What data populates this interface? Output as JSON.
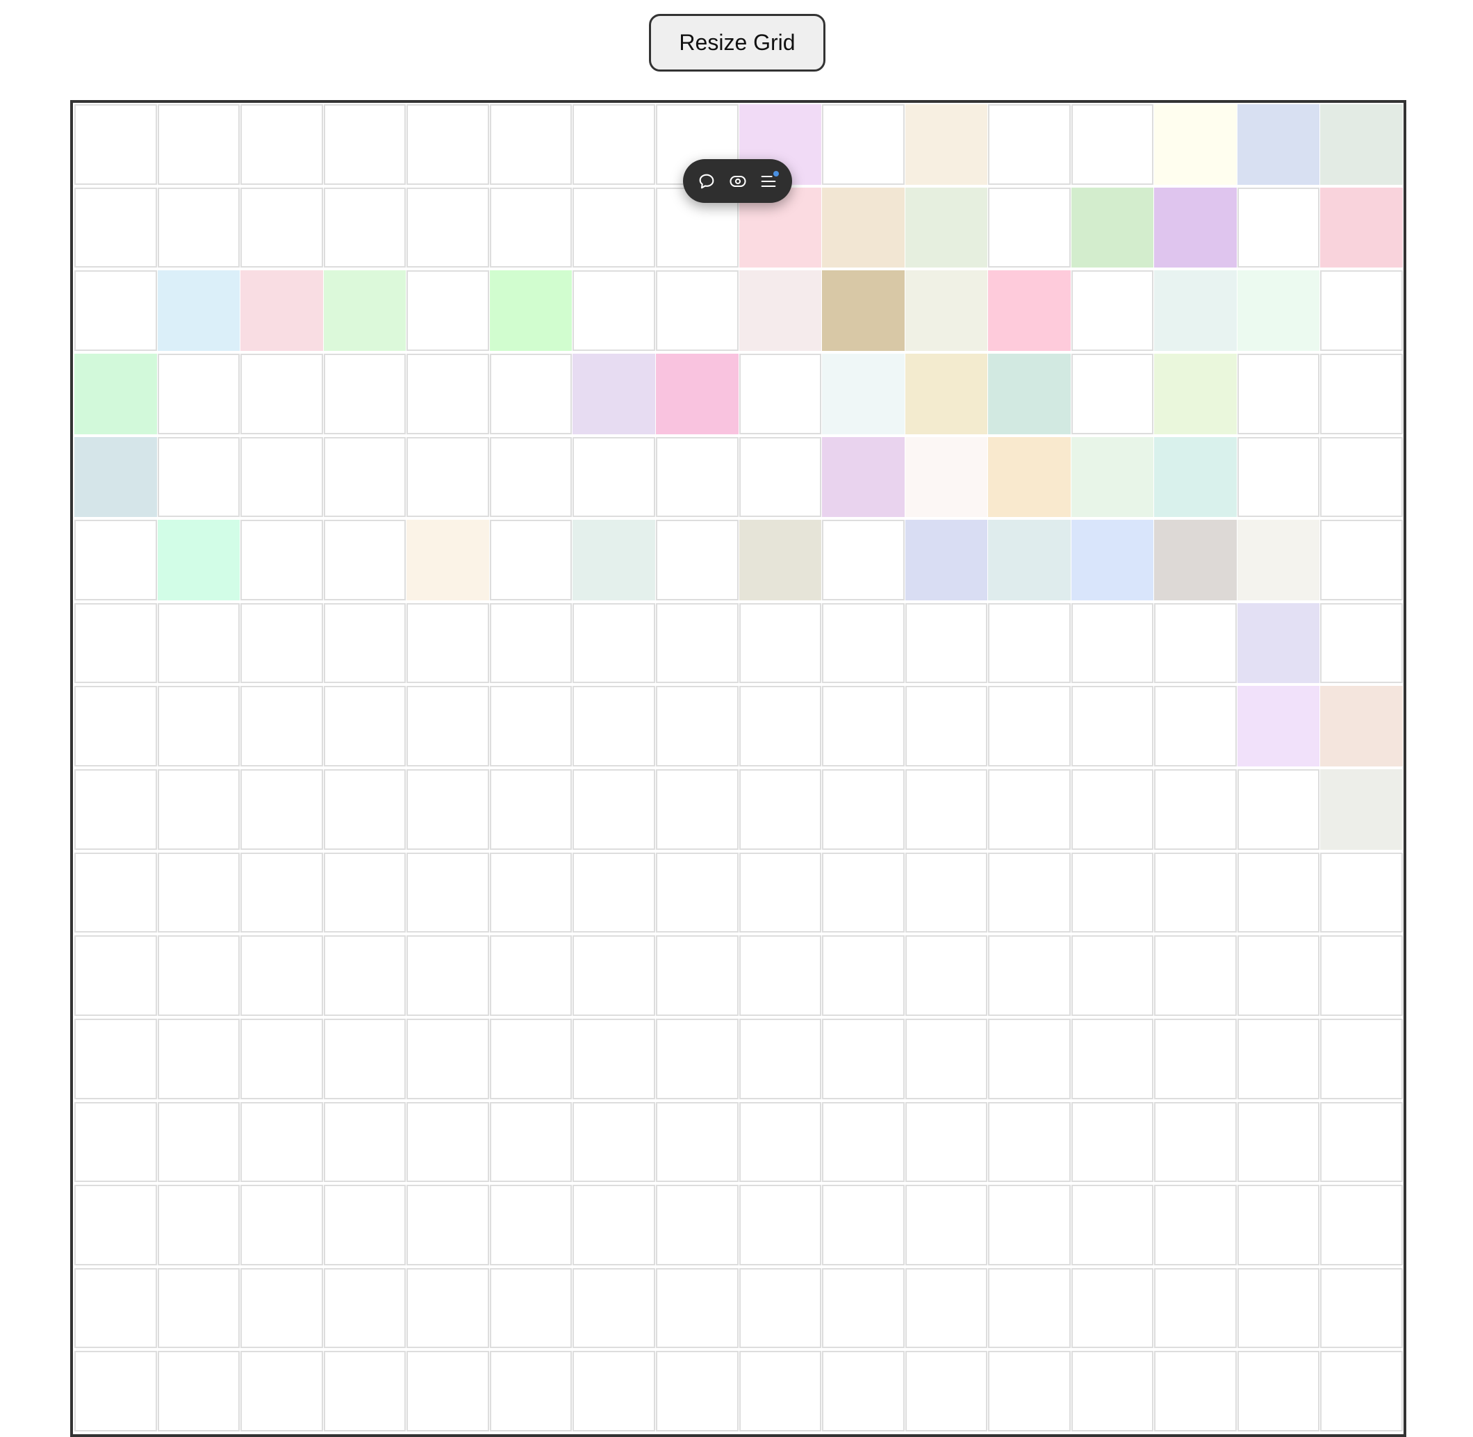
{
  "toolbar": {
    "resize_label": "Resize Grid"
  },
  "grid": {
    "rows": 16,
    "cols": 16,
    "empty_color": "#ffffff",
    "filled_cells": [
      {
        "r": 0,
        "c": 8,
        "color": "#f1dbf6"
      },
      {
        "r": 0,
        "c": 10,
        "color": "#f7efe1"
      },
      {
        "r": 0,
        "c": 13,
        "color": "#fffeef"
      },
      {
        "r": 0,
        "c": 14,
        "color": "#d8e0f2"
      },
      {
        "r": 0,
        "c": 15,
        "color": "#e3ebe4"
      },
      {
        "r": 1,
        "c": 8,
        "color": "#fbdbe1"
      },
      {
        "r": 1,
        "c": 9,
        "color": "#f2e6d3"
      },
      {
        "r": 1,
        "c": 10,
        "color": "#e6efdf"
      },
      {
        "r": 1,
        "c": 12,
        "color": "#d3edcd"
      },
      {
        "r": 1,
        "c": 13,
        "color": "#dfc5ee"
      },
      {
        "r": 1,
        "c": 15,
        "color": "#f9d3dc"
      },
      {
        "r": 2,
        "c": 1,
        "color": "#dbeff9"
      },
      {
        "r": 2,
        "c": 2,
        "color": "#f9dde3"
      },
      {
        "r": 2,
        "c": 3,
        "color": "#dcf9da"
      },
      {
        "r": 2,
        "c": 5,
        "color": "#d1fdcf"
      },
      {
        "r": 2,
        "c": 8,
        "color": "#f5ebec"
      },
      {
        "r": 2,
        "c": 9,
        "color": "#d8c8a6"
      },
      {
        "r": 2,
        "c": 10,
        "color": "#f0f1e5"
      },
      {
        "r": 2,
        "c": 11,
        "color": "#fecbdb"
      },
      {
        "r": 2,
        "c": 13,
        "color": "#e8f3f1"
      },
      {
        "r": 2,
        "c": 14,
        "color": "#ecfaf0"
      },
      {
        "r": 3,
        "c": 0,
        "color": "#d2f9da"
      },
      {
        "r": 3,
        "c": 6,
        "color": "#e7dcf2"
      },
      {
        "r": 3,
        "c": 7,
        "color": "#f9c3df"
      },
      {
        "r": 3,
        "c": 9,
        "color": "#eff7f7"
      },
      {
        "r": 3,
        "c": 10,
        "color": "#f3ebcf"
      },
      {
        "r": 3,
        "c": 11,
        "color": "#d2e9e1"
      },
      {
        "r": 3,
        "c": 13,
        "color": "#eaf7dc"
      },
      {
        "r": 4,
        "c": 0,
        "color": "#d5e5e9"
      },
      {
        "r": 4,
        "c": 9,
        "color": "#e9d3ee"
      },
      {
        "r": 4,
        "c": 10,
        "color": "#fcf7f5"
      },
      {
        "r": 4,
        "c": 11,
        "color": "#f9e9ce"
      },
      {
        "r": 4,
        "c": 12,
        "color": "#e8f5e8"
      },
      {
        "r": 4,
        "c": 13,
        "color": "#d9f1ec"
      },
      {
        "r": 5,
        "c": 1,
        "color": "#d2fde7"
      },
      {
        "r": 5,
        "c": 4,
        "color": "#fbf3e7"
      },
      {
        "r": 5,
        "c": 6,
        "color": "#e4f0ec"
      },
      {
        "r": 5,
        "c": 8,
        "color": "#e6e4d8"
      },
      {
        "r": 5,
        "c": 10,
        "color": "#d9ddf3"
      },
      {
        "r": 5,
        "c": 11,
        "color": "#dfeced"
      },
      {
        "r": 5,
        "c": 12,
        "color": "#d9e5fb"
      },
      {
        "r": 5,
        "c": 13,
        "color": "#ddd9d6"
      },
      {
        "r": 5,
        "c": 14,
        "color": "#f4f3ee"
      },
      {
        "r": 6,
        "c": 14,
        "color": "#e3e0f4"
      },
      {
        "r": 7,
        "c": 14,
        "color": "#f1e1fa"
      },
      {
        "r": 7,
        "c": 15,
        "color": "#f4e5dd"
      },
      {
        "r": 8,
        "c": 15,
        "color": "#edeee9"
      }
    ]
  },
  "floating_toolbar": {
    "background": "#2f2f2f",
    "icon_color": "#ffffff",
    "dot_color": "#4a90e2",
    "icons": [
      "comment-icon",
      "eye-icon",
      "menu-icon"
    ]
  }
}
